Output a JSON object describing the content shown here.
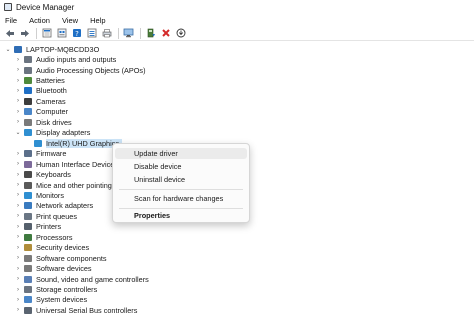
{
  "window": {
    "title": "Device Manager"
  },
  "menu": [
    "File",
    "Action",
    "View",
    "Help"
  ],
  "toolbar": {
    "buttons": [
      "back-arrow-icon",
      "forward-arrow-icon",
      "properties-icon",
      "show-hidden-icon",
      "help-icon",
      "list-view-icon",
      "print-icon",
      "scan-hardware-icon",
      "update-driver-icon",
      "uninstall-x-icon",
      "download-icon"
    ],
    "colors": {
      "uninstall": "#d42a2a",
      "accent": "#1f6fc5"
    }
  },
  "tree": {
    "root": "LAPTOP-MQBCDD3O",
    "categories": [
      "Audio inputs and outputs",
      "Audio Processing Objects (APOs)",
      "Batteries",
      "Bluetooth",
      "Cameras",
      "Computer",
      "Disk drives",
      "Display adapters",
      "Firmware",
      "Human Interface Devices",
      "Keyboards",
      "Mice and other pointing",
      "Monitors",
      "Network adapters",
      "Print queues",
      "Printers",
      "Processors",
      "Security devices",
      "Software components",
      "Software devices",
      "Sound, video and game controllers",
      "Storage controllers",
      "System devices",
      "Universal Serial Bus controllers"
    ],
    "expanded_child": "Intel(R) UHD Graphics"
  },
  "context_menu": {
    "items": [
      "Update driver",
      "Disable device",
      "Uninstall device",
      "Scan for hardware changes",
      "Properties"
    ]
  }
}
